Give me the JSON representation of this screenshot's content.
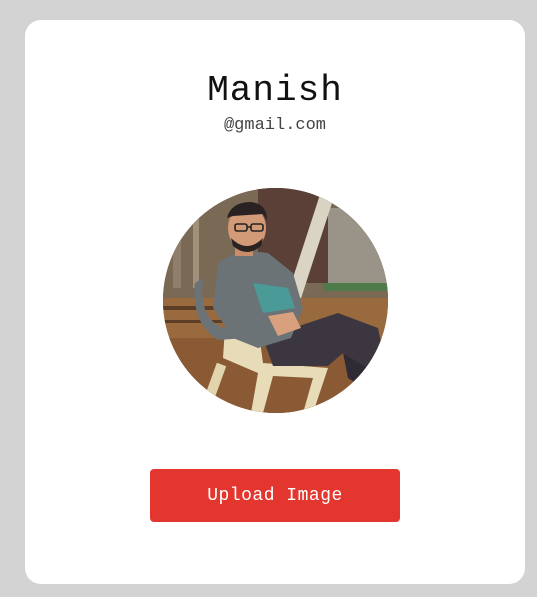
{
  "profile": {
    "name": "Manish",
    "email": "@gmail.com"
  },
  "upload_button": {
    "label": "Upload Image"
  },
  "colors": {
    "page_background": "#d3d3d3",
    "card_background": "#ffffff",
    "button_background": "#e3362e",
    "button_text": "#ffffff"
  }
}
